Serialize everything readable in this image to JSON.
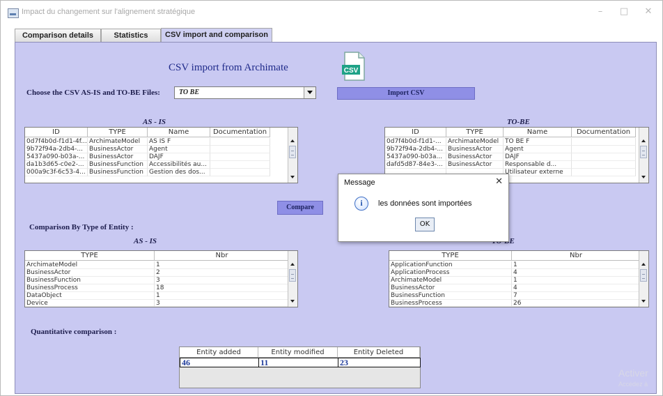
{
  "window": {
    "title": "Impact du changement sur l'alignement stratégique",
    "minimize": "–",
    "maximize": "□",
    "close": "✕"
  },
  "tabs": [
    "Comparison details",
    "Statistics",
    "CSV import and comparison"
  ],
  "main": {
    "heading": "CSV import from Archimate",
    "csv_icon_label": "CSV",
    "choose_label": "Choose the CSV AS-IS and TO-BE Files:",
    "file_select_value": "TO BE",
    "import_button": "Import CSV",
    "as_is_label": "AS - IS",
    "to_be_label": "TO-BE",
    "compare_button": "Compare",
    "by_type_label": "Comparison By Type of Entity :",
    "quant_label": "Quantitative comparison :"
  },
  "as_is_table": {
    "headers": [
      "ID",
      "TYPE",
      "Name",
      "Documentation"
    ],
    "rows": [
      [
        "0d7f4b0d-f1d1-4f...",
        "ArchimateModel",
        "AS IS F",
        ""
      ],
      [
        "9b72f94a-2db4-...",
        "BusinessActor",
        "Agent",
        ""
      ],
      [
        "5437a090-b03a-...",
        "BusinessActor",
        "DAJF",
        ""
      ],
      [
        "da1b3d65-c0e2-...",
        "BusinessFunction",
        "Accessibilités au...",
        ""
      ],
      [
        "000a9c3f-6c53-4...",
        "BusinessFunction",
        "Gestion des dos...",
        ""
      ]
    ]
  },
  "to_be_table": {
    "headers": [
      "ID",
      "TYPE",
      "Name",
      "Documentation"
    ],
    "rows": [
      [
        "0d7f4b0d-f1d1-...",
        "ArchimateModel",
        "TO BE F",
        ""
      ],
      [
        "9b72f94a-2db4-...",
        "BusinessActor",
        "Agent",
        ""
      ],
      [
        "5437a090-b03a...",
        "BusinessActor",
        "DAJF",
        ""
      ],
      [
        "dafd5d87-84e3-...",
        "BusinessActor",
        "Responsable d...",
        ""
      ],
      [
        "",
        "",
        "Utilisateur externe",
        ""
      ]
    ]
  },
  "as_is_type_table": {
    "headers": [
      "TYPE",
      "Nbr"
    ],
    "rows": [
      [
        "ArchimateModel",
        "1"
      ],
      [
        "BusinessActor",
        "2"
      ],
      [
        "BusinessFunction",
        "3"
      ],
      [
        "BusinessProcess",
        "18"
      ],
      [
        "DataObject",
        "1"
      ],
      [
        "Device",
        "3"
      ]
    ]
  },
  "to_be_type_table": {
    "headers": [
      "TYPE",
      "Nbr"
    ],
    "rows": [
      [
        "ApplicationFunction",
        "1"
      ],
      [
        "ApplicationProcess",
        "4"
      ],
      [
        "ArchimateModel",
        "1"
      ],
      [
        "BusinessActor",
        "4"
      ],
      [
        "BusinessFunction",
        "7"
      ],
      [
        "BusinessProcess",
        "26"
      ]
    ]
  },
  "quant_table": {
    "headers": [
      "Entity added",
      "Entity modified",
      "Entity Deleted"
    ],
    "values": [
      "46",
      "11",
      "23"
    ]
  },
  "dialog": {
    "title": "Message",
    "close": "✕",
    "icon": "info-icon",
    "message": "les données sont importées",
    "ok": "OK"
  },
  "watermark": {
    "line1": "Activer",
    "line2": "Accédez à"
  }
}
